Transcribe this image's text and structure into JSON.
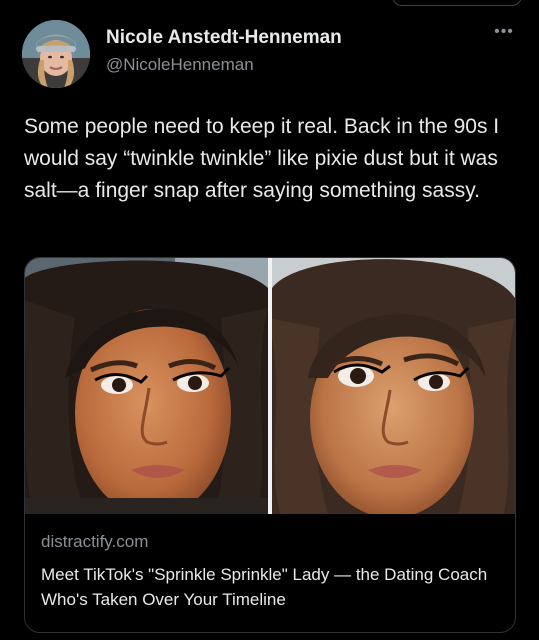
{
  "tweet": {
    "author": {
      "display_name": "Nicole Anstedt-Henneman",
      "handle": "@NicoleHenneman"
    },
    "more_icon": "more-horizontal-icon",
    "more_glyph": "•••",
    "text": "Some people need to keep it real. Back in the 90s I would say “twinkle twinkle” like pixie dust but it was salt—a finger snap after saying something sassy.",
    "link_card": {
      "domain": "distractify.com",
      "title": "Meet TikTok's \"Sprinkle Sprinkle\" Lady — the Dating Coach Who's Taken Over Your Timeline"
    }
  },
  "colors": {
    "background": "#000000",
    "primary_text": "#e7e9ea",
    "secondary_text": "#8b9097",
    "card_border": "#2f3336"
  }
}
